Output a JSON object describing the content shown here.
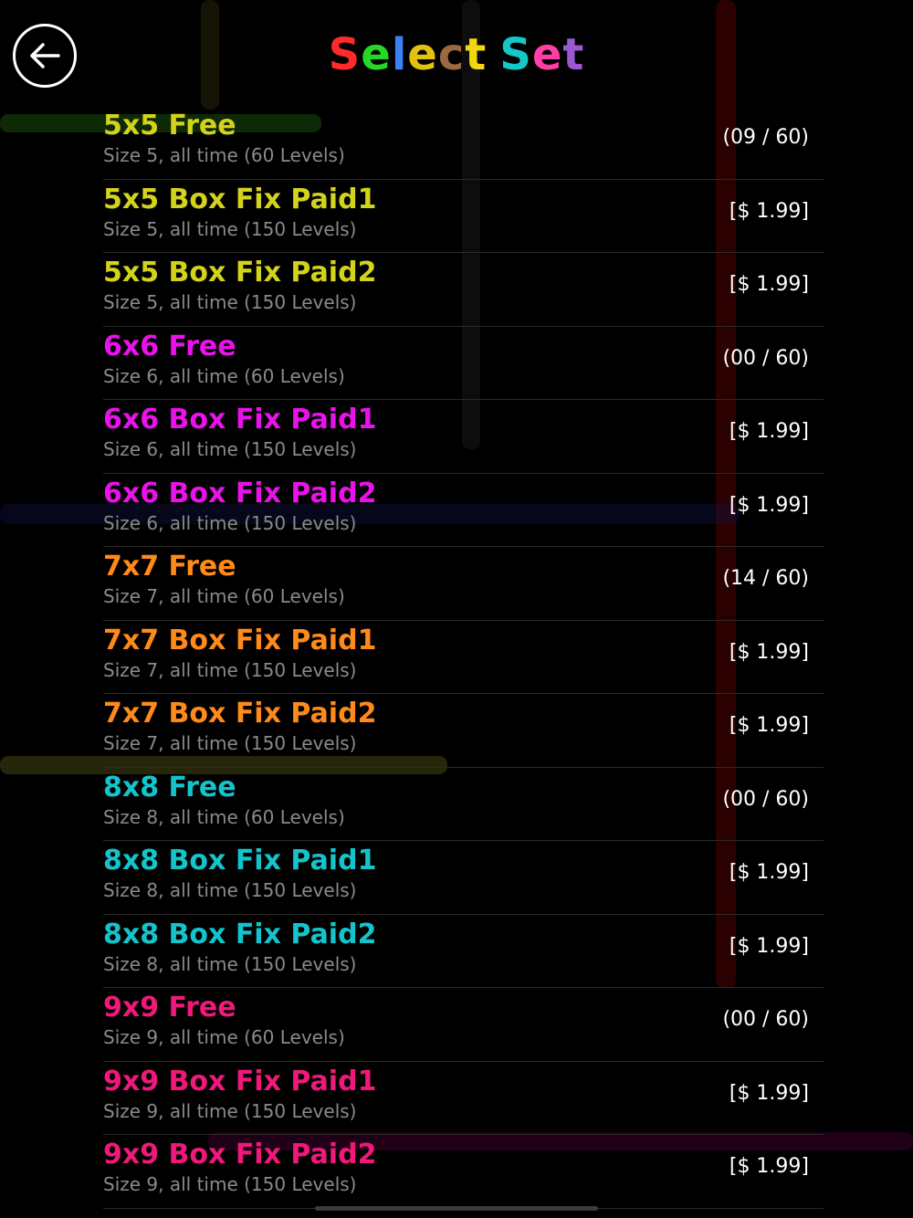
{
  "header": {
    "back_icon": "arrow-left-icon",
    "title_letters": [
      {
        "ch": "S",
        "color": "#ff2a2a"
      },
      {
        "ch": "e",
        "color": "#26d826"
      },
      {
        "ch": "l",
        "color": "#3b82f6"
      },
      {
        "ch": "e",
        "color": "#e2c20e"
      },
      {
        "ch": "c",
        "color": "#9b6a42"
      },
      {
        "ch": "t",
        "color": "#f1d80e"
      },
      {
        "ch": " ",
        "color": "#ffffff"
      },
      {
        "ch": "S",
        "color": "#14c8c8"
      },
      {
        "ch": "e",
        "color": "#ff3ea8"
      },
      {
        "ch": "t",
        "color": "#9b59d0"
      }
    ]
  },
  "colors": {
    "size5": "#d2d31a",
    "size6": "#ea12ea",
    "size7": "#ff8a1a",
    "size8": "#14c4cc",
    "size9": "#f0187a"
  },
  "sets": [
    {
      "name": "5x5 Free",
      "desc": "Size 5, all time (60 Levels)",
      "status": "(09 / 60)",
      "color": "#d2d31a"
    },
    {
      "name": "5x5 Box Fix Paid1",
      "desc": "Size 5, all time (150 Levels)",
      "status": "[$ 1.99]",
      "color": "#d2d31a"
    },
    {
      "name": "5x5 Box Fix Paid2",
      "desc": "Size 5, all time (150 Levels)",
      "status": "[$ 1.99]",
      "color": "#d2d31a"
    },
    {
      "name": "6x6 Free",
      "desc": "Size 6, all time (60 Levels)",
      "status": "(00 / 60)",
      "color": "#ea12ea"
    },
    {
      "name": "6x6 Box Fix Paid1",
      "desc": "Size 6, all time (150 Levels)",
      "status": "[$ 1.99]",
      "color": "#ea12ea"
    },
    {
      "name": "6x6 Box Fix Paid2",
      "desc": "Size 6, all time (150 Levels)",
      "status": "[$ 1.99]",
      "color": "#ea12ea"
    },
    {
      "name": "7x7 Free",
      "desc": "Size 7, all time (60 Levels)",
      "status": "(14 / 60)",
      "color": "#ff8a1a"
    },
    {
      "name": "7x7 Box Fix Paid1",
      "desc": "Size 7, all time (150 Levels)",
      "status": "[$ 1.99]",
      "color": "#ff8a1a"
    },
    {
      "name": "7x7 Box Fix Paid2",
      "desc": "Size 7, all time (150 Levels)",
      "status": "[$ 1.99]",
      "color": "#ff8a1a"
    },
    {
      "name": "8x8 Free",
      "desc": "Size 8, all time (60 Levels)",
      "status": "(00 / 60)",
      "color": "#14c4cc"
    },
    {
      "name": "8x8 Box Fix Paid1",
      "desc": "Size 8, all time (150 Levels)",
      "status": "[$ 1.99]",
      "color": "#14c4cc"
    },
    {
      "name": "8x8 Box Fix Paid2",
      "desc": "Size 8, all time (150 Levels)",
      "status": "[$ 1.99]",
      "color": "#14c4cc"
    },
    {
      "name": "9x9 Free",
      "desc": "Size 9, all time (60 Levels)",
      "status": "(00 / 60)",
      "color": "#f0187a"
    },
    {
      "name": "9x9 Box Fix Paid1",
      "desc": "Size 9, all time (150 Levels)",
      "status": "[$ 1.99]",
      "color": "#f0187a"
    },
    {
      "name": "9x9 Box Fix Paid2",
      "desc": "Size 9, all time (150 Levels)",
      "status": "[$ 1.99]",
      "color": "#f0187a"
    }
  ]
}
